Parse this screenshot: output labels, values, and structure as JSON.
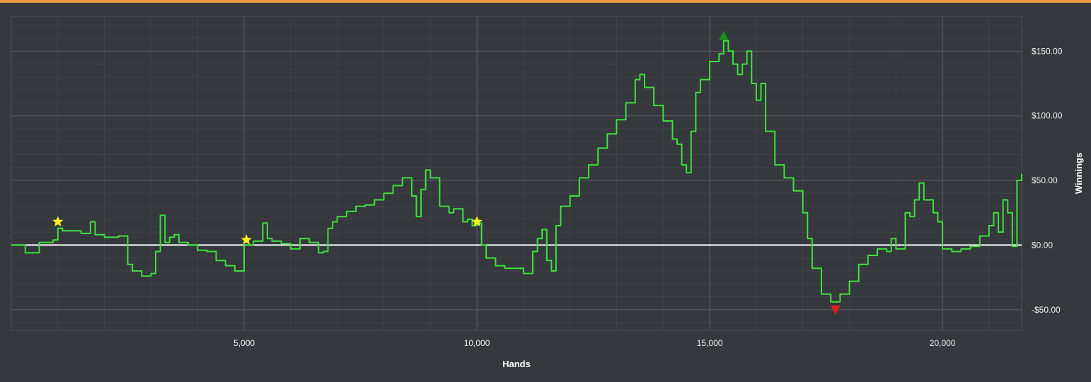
{
  "chart_data": {
    "type": "line",
    "xlabel": "Hands",
    "ylabel": "Winnings",
    "xlim": [
      0,
      21700
    ],
    "ylim": [
      -66,
      177
    ],
    "x_ticks": [
      5000,
      10000,
      15000,
      20000
    ],
    "x_tick_labels": [
      "5,000",
      "10,000",
      "15,000",
      "20,000"
    ],
    "y_ticks": [
      -50,
      0,
      50,
      100,
      150
    ],
    "y_tick_labels": [
      "-$50.00",
      "$0.00",
      "$50.00",
      "$100.00",
      "$150.00"
    ],
    "grid": true,
    "colors": {
      "background": "#35383c",
      "line": "#3ee03e",
      "zero_line": "#ffffff",
      "accent_bar": "#e39a3b",
      "max_marker": "#1c8a1c",
      "min_marker": "#e01e1e",
      "star_marker": "#f5f223"
    },
    "series": [
      {
        "x": [
          0,
          300,
          600,
          900,
          1000,
          1100,
          1500,
          1700,
          1800,
          2000,
          2300,
          2500,
          2600,
          2800,
          3000,
          3100,
          3200,
          3300,
          3400,
          3500,
          3600,
          3800,
          4000,
          4200,
          4400,
          4600,
          4800,
          5000,
          5200,
          5400,
          5500,
          5600,
          5800,
          6000,
          6200,
          6400,
          6600,
          6700,
          6800,
          6900,
          7000,
          7200,
          7400,
          7600,
          7800,
          8000,
          8200,
          8400,
          8600,
          8700,
          8800,
          8900,
          9000,
          9200,
          9400,
          9500,
          9600,
          9700,
          9800,
          9900,
          10000,
          10100,
          10200,
          10400,
          10600,
          10800,
          11000,
          11200,
          11300,
          11400,
          11500,
          11600,
          11700,
          11800,
          12000,
          12200,
          12400,
          12600,
          12800,
          13000,
          13200,
          13400,
          13500,
          13600,
          13800,
          14000,
          14200,
          14300,
          14400,
          14500,
          14600,
          14700,
          14800,
          15000,
          15200,
          15300,
          15400,
          15500,
          15600,
          15700,
          15800,
          15900,
          16000,
          16100,
          16200,
          16400,
          16600,
          16800,
          17000,
          17100,
          17200,
          17400,
          17600,
          17800,
          18000,
          18200,
          18400,
          18600,
          18800,
          18900,
          19000,
          19200,
          19300,
          19400,
          19500,
          19600,
          19800,
          19900,
          20000,
          20200,
          20400,
          20600,
          20800,
          21000,
          21100,
          21200,
          21300,
          21400,
          21500,
          21600,
          21700
        ],
        "y": [
          0,
          -6,
          2,
          4,
          13,
          11,
          9,
          18,
          8,
          6,
          7,
          -15,
          -20,
          -24,
          -22,
          -5,
          23,
          2,
          6,
          8,
          2,
          0,
          -4,
          -5,
          -12,
          -16,
          -20,
          0,
          3,
          17,
          5,
          3,
          1,
          -3,
          5,
          2,
          -6,
          -5,
          13,
          18,
          22,
          26,
          30,
          31,
          35,
          40,
          46,
          52,
          38,
          22,
          43,
          58,
          52,
          30,
          25,
          28,
          28,
          18,
          20,
          15,
          17,
          0,
          -10,
          -16,
          -18,
          -18,
          -22,
          -5,
          5,
          12,
          -12,
          -20,
          15,
          30,
          38,
          52,
          62,
          75,
          86,
          97,
          110,
          128,
          132,
          122,
          108,
          96,
          82,
          78,
          62,
          56,
          88,
          118,
          128,
          142,
          148,
          158,
          150,
          140,
          132,
          140,
          150,
          125,
          112,
          125,
          88,
          62,
          52,
          42,
          25,
          5,
          -18,
          -38,
          -44,
          -38,
          -28,
          -15,
          -8,
          -3,
          -5,
          5,
          -3,
          25,
          22,
          35,
          48,
          35,
          25,
          18,
          -3,
          -5,
          -3,
          -1,
          7,
          15,
          25,
          10,
          35,
          25,
          -1,
          50,
          55
        ]
      }
    ],
    "markers": [
      {
        "type": "max",
        "x": 15300,
        "y": 162
      },
      {
        "type": "min",
        "x": 17700,
        "y": -50
      },
      {
        "type": "star",
        "x": 1000,
        "y": 18
      },
      {
        "type": "star",
        "x": 5050,
        "y": 4
      },
      {
        "type": "star",
        "x": 10000,
        "y": 18
      }
    ]
  }
}
